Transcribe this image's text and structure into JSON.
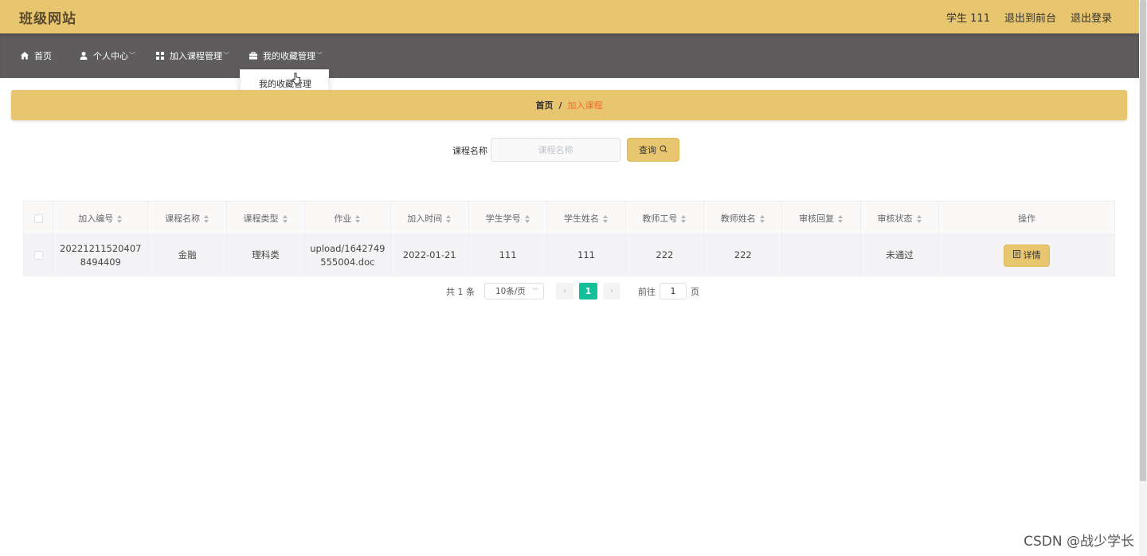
{
  "header": {
    "site_title": "班级网站",
    "user_label": "学生 111",
    "back_link": "退出到前台",
    "logout_link": "退出登录"
  },
  "nav": {
    "items": [
      {
        "label": "首页",
        "icon": "home-icon"
      },
      {
        "label": "个人中心",
        "icon": "user-icon"
      },
      {
        "label": "加入课程管理",
        "icon": "grid-icon"
      },
      {
        "label": "我的收藏管理",
        "icon": "briefcase-icon"
      }
    ],
    "dropdown_item": "我的收藏管理"
  },
  "breadcrumb": {
    "home": "首页",
    "separator": "/",
    "current": "加入课程"
  },
  "search": {
    "label": "课程名称",
    "placeholder": "课程名称",
    "button": "查询"
  },
  "table": {
    "columns": [
      "加入编号",
      "课程名称",
      "课程类型",
      "作业",
      "加入时间",
      "学生学号",
      "学生姓名",
      "教师工号",
      "教师姓名",
      "审核回复",
      "审核状态",
      "操作"
    ],
    "rows": [
      {
        "id": "20221211520407 8494409",
        "course_name": "金融",
        "course_type": "理科类",
        "homework": "upload/1642749 555004.doc",
        "join_time": "2022-01-21",
        "student_no": "111",
        "student_name": "111",
        "teacher_no": "222",
        "teacher_name": "222",
        "review_reply": "",
        "review_status": "未通过",
        "action": "详情"
      }
    ]
  },
  "pagination": {
    "total": "共 1 条",
    "page_size": "10条/页",
    "current_page": "1",
    "goto_label": "前往",
    "goto_value": "1",
    "page_suffix": "页"
  },
  "watermark": "CSDN @战少学长",
  "colors": {
    "header_bg": "#e8c56f",
    "nav_bg": "#5e5c5c",
    "accent_orange": "#f56c2a",
    "page_active": "#13c09a"
  }
}
